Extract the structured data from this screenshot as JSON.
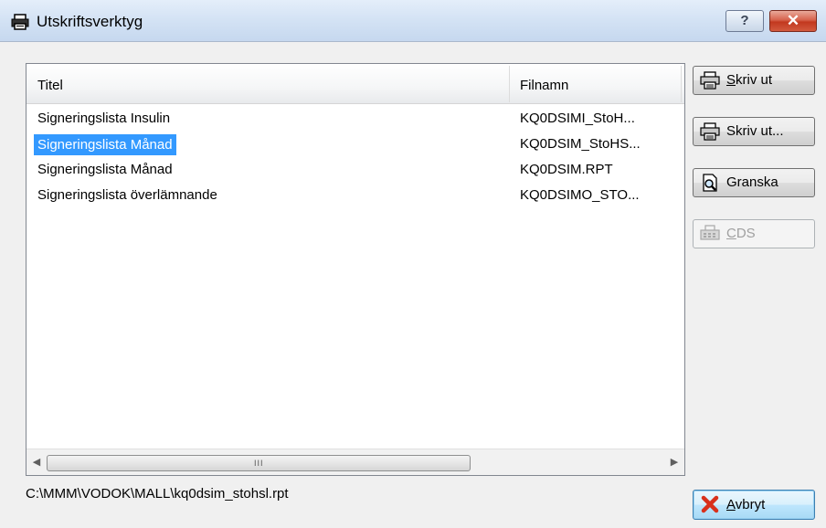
{
  "window": {
    "title": "Utskriftsverktyg",
    "help_label": "?",
    "close_label": "✕"
  },
  "list": {
    "columns": [
      "Titel",
      "Filnamn"
    ],
    "rows": [
      {
        "titel": "Signeringslista Insulin",
        "filnamn": "KQ0DSIMI_StoH...",
        "selected": false
      },
      {
        "titel": "Signeringslista Månad",
        "filnamn": "KQ0DSIM_StoHS...",
        "selected": true
      },
      {
        "titel": "Signeringslista Månad",
        "filnamn": "KQ0DSIM.RPT",
        "selected": false
      },
      {
        "titel": "Signeringslista överlämnande",
        "filnamn": "KQ0DSIMO_STO...",
        "selected": false
      }
    ],
    "scroll_left": "◀",
    "scroll_right": "▶",
    "scroll_grip": "III"
  },
  "buttons": {
    "print": {
      "mnemonic": "S",
      "rest": "kriv ut",
      "icon": "printer-icon"
    },
    "print_dialog": {
      "label": "Skriv ut...",
      "icon": "printer-icon"
    },
    "preview": {
      "label": "Granska",
      "icon": "preview-icon"
    },
    "cds": {
      "mnemonic": "C",
      "rest": "DS",
      "icon": "fax-icon",
      "disabled": true
    },
    "cancel": {
      "mnemonic": "A",
      "rest": "vbryt",
      "icon": "red-x-icon"
    }
  },
  "status": {
    "path": "C:\\MMM\\VODOK\\MALL\\kq0dsim_stohsl.rpt"
  },
  "colors": {
    "selection": "#3399ff",
    "title_gradient_top": "#e4eefa",
    "close_red": "#c2381f"
  }
}
